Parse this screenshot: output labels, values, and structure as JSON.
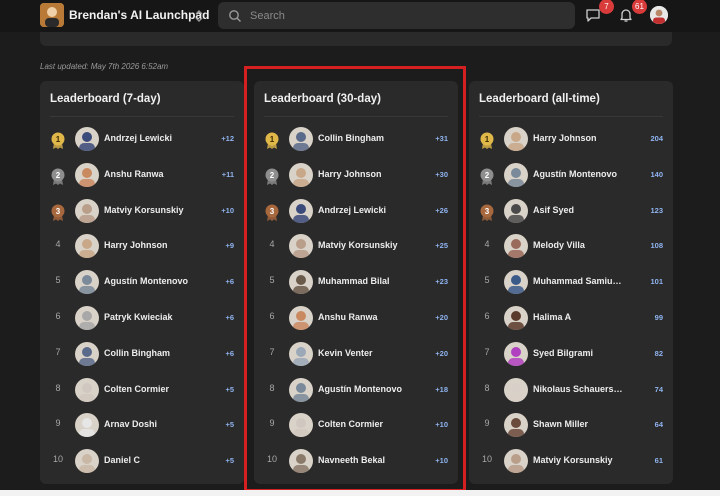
{
  "header": {
    "app_name": "Brendan's AI Launchpad",
    "search_placeholder": "Search",
    "messages_badge": "7",
    "notifications_badge": "61"
  },
  "last_updated": "Last updated: May 7th 2026 6:52am",
  "colors": {
    "accent_points": "#8fb4f0",
    "gold": "#e0b84a",
    "silver": "#8e8e8e",
    "bronze": "#a8683e",
    "highlight": "#d42020"
  },
  "boards": [
    {
      "title": "Leaderboard (7-day)",
      "entries": [
        {
          "rank": "1",
          "name": "Andrzej Lewicki",
          "points": "+12",
          "avatar": "#3a4a7a"
        },
        {
          "rank": "2",
          "name": "Anshu Ranwa",
          "points": "+11",
          "avatar": "#c98a60"
        },
        {
          "rank": "3",
          "name": "Matviy Korsunskiy",
          "points": "+10",
          "avatar": "#b99e8a"
        },
        {
          "rank": "4",
          "name": "Harry Johnson",
          "points": "+9",
          "avatar": "#c8a888"
        },
        {
          "rank": "5",
          "name": "Agustín Montenovo",
          "points": "+6",
          "avatar": "#7a8a9a"
        },
        {
          "rank": "6",
          "name": "Patryk Kwieciak",
          "points": "+6",
          "avatar": "#a8a8a8"
        },
        {
          "rank": "7",
          "name": "Collin Bingham",
          "points": "+6",
          "avatar": "#5a6a8a"
        },
        {
          "rank": "8",
          "name": "Colten Cormier",
          "points": "+5",
          "avatar": "#d0c8c0"
        },
        {
          "rank": "9",
          "name": "Arnav Doshi",
          "points": "+5",
          "avatar": "#e6e6e6"
        },
        {
          "rank": "10",
          "name": "Daniel C",
          "points": "+5",
          "avatar": "#c9b8a6"
        }
      ]
    },
    {
      "title": "Leaderboard (30-day)",
      "entries": [
        {
          "rank": "1",
          "name": "Collin Bingham",
          "points": "+31",
          "avatar": "#5a6a8a"
        },
        {
          "rank": "2",
          "name": "Harry Johnson",
          "points": "+30",
          "avatar": "#c8a888"
        },
        {
          "rank": "3",
          "name": "Andrzej Lewicki",
          "points": "+26",
          "avatar": "#3a4a7a"
        },
        {
          "rank": "4",
          "name": "Matviy Korsunskiy",
          "points": "+25",
          "avatar": "#b99e8a"
        },
        {
          "rank": "5",
          "name": "Muhammad Bilal",
          "points": "+23",
          "avatar": "#6a5a4a"
        },
        {
          "rank": "6",
          "name": "Anshu Ranwa",
          "points": "+20",
          "avatar": "#c98a60"
        },
        {
          "rank": "7",
          "name": "Kevin Venter",
          "points": "+20",
          "avatar": "#9aa8b8"
        },
        {
          "rank": "8",
          "name": "Agustín Montenovo",
          "points": "+18",
          "avatar": "#7a8a9a"
        },
        {
          "rank": "9",
          "name": "Colten Cormier",
          "points": "+10",
          "avatar": "#d0c8c0"
        },
        {
          "rank": "10",
          "name": "Navneeth Bekal",
          "points": "+10",
          "avatar": "#8a7a6a"
        }
      ]
    },
    {
      "title": "Leaderboard (all-time)",
      "entries": [
        {
          "rank": "1",
          "name": "Harry Johnson",
          "points": "204",
          "avatar": "#c8a888"
        },
        {
          "rank": "2",
          "name": "Agustín Montenovo",
          "points": "140",
          "avatar": "#7a8a9a"
        },
        {
          "rank": "3",
          "name": "Asif Syed",
          "points": "123",
          "avatar": "#4a4a4a"
        },
        {
          "rank": "4",
          "name": "Melody Villa",
          "points": "108",
          "avatar": "#9a6a5a"
        },
        {
          "rank": "5",
          "name": "Muhammad Samiu…",
          "points": "101",
          "avatar": "#3a5a8a"
        },
        {
          "rank": "6",
          "name": "Halima A",
          "points": "99",
          "avatar": "#5a3a2a"
        },
        {
          "rank": "7",
          "name": "Syed Bilgrami",
          "points": "82",
          "avatar": "#b040c0"
        },
        {
          "rank": "8",
          "name": "Nikolaus Schauers…",
          "points": "74",
          "avatar": "#d8d0c8"
        },
        {
          "rank": "9",
          "name": "Shawn Miller",
          "points": "64",
          "avatar": "#6a4a3a"
        },
        {
          "rank": "10",
          "name": "Matviy Korsunskiy",
          "points": "61",
          "avatar": "#b99e8a"
        }
      ]
    }
  ]
}
